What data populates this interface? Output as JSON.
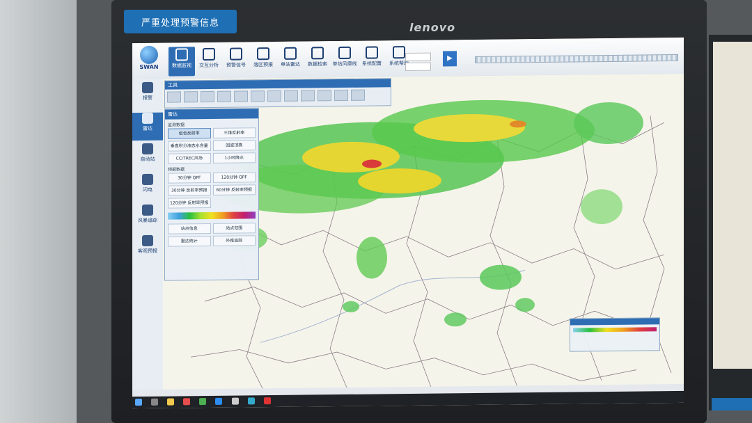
{
  "monitor": {
    "sticker_text": "严重处理预警信息",
    "brand": "lenovo"
  },
  "app": {
    "logo_text": "SWAN",
    "toolbar": [
      {
        "label": "数据监视",
        "icon": "monitor-icon",
        "active": true
      },
      {
        "label": "交互分析",
        "icon": "analysis-icon",
        "active": false
      },
      {
        "label": "预警信号",
        "icon": "warning-icon",
        "active": false
      },
      {
        "label": "落区预报",
        "icon": "forecast-area-icon",
        "active": false
      },
      {
        "label": "单站雷达",
        "icon": "radar-icon",
        "active": false
      },
      {
        "label": "数据检索",
        "icon": "search-icon",
        "active": false
      },
      {
        "label": "单站风廓线",
        "icon": "wind-profile-icon",
        "active": false
      },
      {
        "label": "系统配置",
        "icon": "settings-icon",
        "active": false
      },
      {
        "label": "系统帮助",
        "icon": "help-icon",
        "active": false
      }
    ],
    "sidebar": [
      {
        "label": "报警",
        "icon": "alarm-icon",
        "active": false
      },
      {
        "label": "雷达",
        "icon": "radar-icon",
        "active": true
      },
      {
        "label": "自动站",
        "icon": "station-icon",
        "active": false
      },
      {
        "label": "闪电",
        "icon": "lightning-icon",
        "active": false
      },
      {
        "label": "风暴追踪",
        "icon": "storm-icon",
        "active": false
      },
      {
        "label": "客观预报",
        "icon": "objective-forecast-icon",
        "active": false
      }
    ],
    "panel": {
      "title": "雷达",
      "section1": "监测数据",
      "buttons1": [
        "组合反射率",
        "三维反射率",
        "垂直积分液态水含量",
        "回波顶高",
        "CC/TREC风场",
        "1小时降水"
      ],
      "section2": "预报数据",
      "buttons2": [
        "30分钟 QPF",
        "120分钟 QPF",
        "30分钟 反射率预报",
        "60分钟 反射率预报",
        "120分钟 反射率预报"
      ],
      "buttons3": [
        "站点信息",
        "站点范围",
        "雷达统计",
        "外推追踪"
      ]
    },
    "top_panel_title": "工具",
    "play_icon": "play-icon"
  }
}
